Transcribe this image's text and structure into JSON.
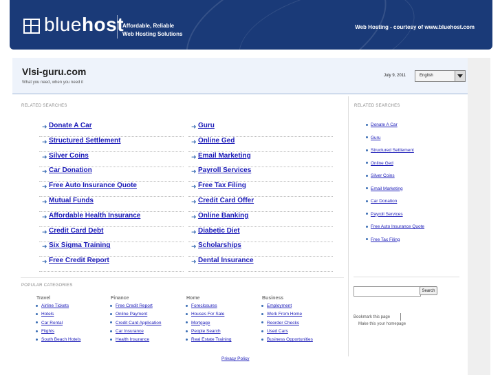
{
  "banner": {
    "logo_light": "blue",
    "logo_bold": "host",
    "tagline_1": "Affordable, Reliable",
    "tagline_2": "Web Hosting Solutions",
    "courtesy": "Web Hosting - courtesy of www.bluehost.com",
    "bg_color": "#1a3a78"
  },
  "site": {
    "name": "Vlsi-guru.com",
    "slogan": "What you need, when you need it",
    "date": "July 9, 2011",
    "language": "English"
  },
  "related_label": "RELATED SEARCHES",
  "main_links": [
    "Donate A Car",
    "Guru",
    "Structured Settlement",
    "Online Ged",
    "Silver Coins",
    "Email Marketing",
    "Car Donation",
    "Payroll Services",
    "Free Auto Insurance Quote",
    "Free Tax Filing",
    "Mutual Funds",
    "Credit Card Offer",
    "Affordable Health Insurance",
    "Online Banking",
    "Credit Card Debt",
    "Diabetic Diet",
    "Six Sigma Training",
    "Scholarships",
    "Free Credit Report",
    "Dental Insurance"
  ],
  "side_related_label": "RELATED SEARCHES",
  "side_links": [
    "Donate A Car",
    "Guru",
    "Structured Settlement",
    "Online Ged",
    "Silver Coins",
    "Email Marketing",
    "Car Donation",
    "Payroll Services",
    "Free Auto Insurance Quote",
    "Free Tax Filing"
  ],
  "search": {
    "button": "Search",
    "value": ""
  },
  "bookmark": "Bookmark this page",
  "homepage": "Make this your homepage",
  "popular_label": "POPULAR CATEGORIES",
  "categories": [
    {
      "title": "Travel",
      "items": [
        "Airline Tickets",
        "Hotels",
        "Car Rental",
        "Flights",
        "South Beach Hotels"
      ]
    },
    {
      "title": "Finance",
      "items": [
        "Free Credit Report",
        "Online Payment",
        "Credit Card Application",
        "Car Insurance",
        "Health Insurance"
      ]
    },
    {
      "title": "Home",
      "items": [
        "Foreclosures",
        "Houses For Sale",
        "Mortgage",
        "People Search",
        "Real Estate Training"
      ]
    },
    {
      "title": "Business",
      "items": [
        "Employment",
        "Work From Home",
        "Reorder Checks",
        "Used Cars",
        "Business Opportunities"
      ]
    }
  ],
  "privacy": "Privacy Policy"
}
